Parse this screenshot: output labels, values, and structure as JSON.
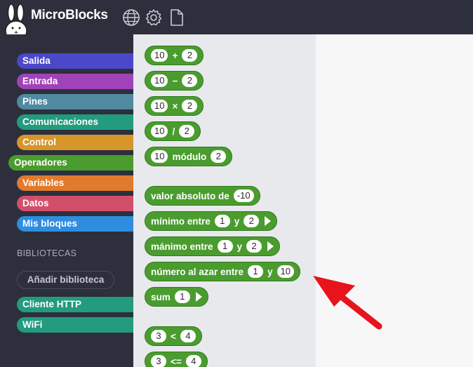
{
  "app": {
    "title": "MicroBlocks"
  },
  "toolbar": {
    "icons": [
      "globe-icon",
      "gear-icon",
      "file-icon"
    ]
  },
  "sidebar": {
    "categories": [
      {
        "label": "Salida",
        "color": "#4b48c9"
      },
      {
        "label": "Entrada",
        "color": "#a143b8"
      },
      {
        "label": "Pines",
        "color": "#4f8aa0"
      },
      {
        "label": "Comunicaciones",
        "color": "#229b7e"
      },
      {
        "label": "Control",
        "color": "#d6962a"
      },
      {
        "label": "Operadores",
        "color": "#4a9c2e"
      },
      {
        "label": "Variables",
        "color": "#e07a2c"
      },
      {
        "label": "Datos",
        "color": "#d24f6a"
      },
      {
        "label": "Mis bloques",
        "color": "#2f8de0"
      }
    ],
    "libraries_label": "BIBLIOTECAS",
    "add_library_label": "Añadir biblioteca",
    "libraries": [
      {
        "label": "Cliente HTTP",
        "color": "#229b7e"
      },
      {
        "label": "WiFi",
        "color": "#229b7e"
      }
    ]
  },
  "palette": {
    "add": {
      "a": "10",
      "op": "+",
      "b": "2"
    },
    "sub": {
      "a": "10",
      "op": "−",
      "b": "2"
    },
    "mul": {
      "a": "10",
      "op": "×",
      "b": "2"
    },
    "div": {
      "a": "10",
      "op": "/",
      "b": "2"
    },
    "mod": {
      "a": "10",
      "op": "módulo",
      "b": "2"
    },
    "abs": {
      "label": "valor absoluto de",
      "a": "-10"
    },
    "min": {
      "label": "mínimo entre",
      "a": "1",
      "y": "y",
      "b": "2"
    },
    "max": {
      "label": "mánimo entre",
      "a": "1",
      "y": "y",
      "b": "2"
    },
    "random": {
      "label": "número al azar entre",
      "a": "1",
      "y": "y",
      "b": "10"
    },
    "sum": {
      "label": "sum",
      "a": "1"
    },
    "lt": {
      "a": "3",
      "op": "<",
      "b": "4"
    },
    "le": {
      "a": "3",
      "op": "<=",
      "b": "4"
    }
  },
  "colors": {
    "operators_block": "#4a9c2e",
    "pointer_arrow": "#e8141b",
    "topbar": "#2d2f3d"
  }
}
